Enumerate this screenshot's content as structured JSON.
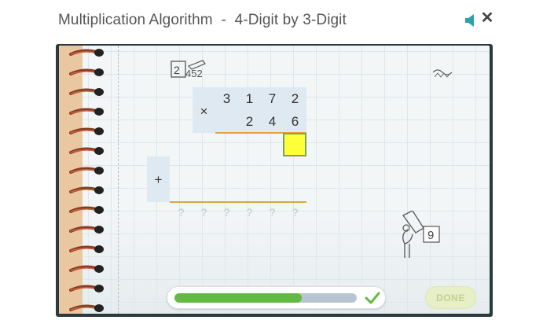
{
  "header": {
    "title": "Multiplication Algorithm  -  4-Digit by 3-Digit",
    "sound_icon": "speaker-icon",
    "close_icon": "close-icon",
    "close_glyph": "✕"
  },
  "problem": {
    "multiplicand": [
      "3",
      "1",
      "7",
      "2"
    ],
    "multiplier": [
      "2",
      "4",
      "6"
    ],
    "times_sign": "×",
    "plus_sign": "+",
    "result_placeholders": [
      "?",
      "?",
      "?",
      "?",
      "?",
      "?"
    ]
  },
  "footer": {
    "progress": 0.7,
    "done_label": "DONE"
  },
  "colors": {
    "progress_fill": "#63b943",
    "answer_box": "#ffff3a",
    "rule_line": "#e2a43c",
    "accent": "#2aa2a8"
  }
}
